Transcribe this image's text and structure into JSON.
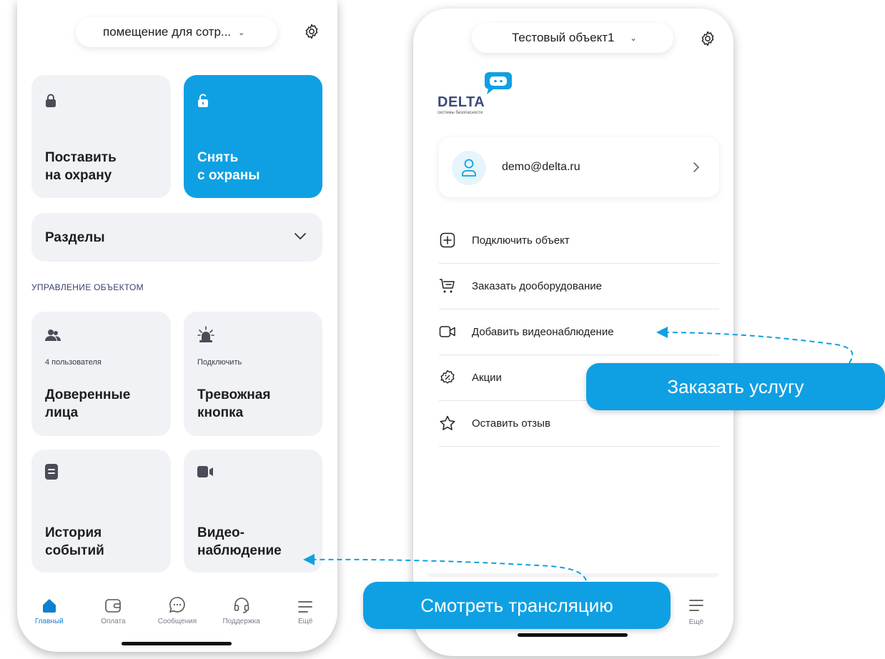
{
  "left_phone": {
    "object_selector": "помещение для сотр...",
    "arm_card": {
      "title_line1": "Поставить",
      "title_line2": "на охрану"
    },
    "disarm_card": {
      "title_line1": "Снять",
      "title_line2": "с охраны"
    },
    "sections": {
      "label": "Разделы"
    },
    "management_label": "УПРАВЛЕНИЕ ОБЪЕКТОМ",
    "trusted": {
      "sub": "4 пользователя",
      "title_line1": "Доверенные",
      "title_line2": "лица"
    },
    "panic": {
      "sub": "Подключить",
      "title_line1": "Тревожная",
      "title_line2": "кнопка"
    },
    "history": {
      "title_line1": "История",
      "title_line2": "событий"
    },
    "video": {
      "title_line1": "Видео-",
      "title_line2": "наблюдение"
    },
    "tabs": [
      {
        "label": "Главный",
        "icon": "home-icon",
        "active": true
      },
      {
        "label": "Оплата",
        "icon": "wallet-icon"
      },
      {
        "label": "Сообщения",
        "icon": "chat-icon"
      },
      {
        "label": "Поддержка",
        "icon": "headset-icon"
      },
      {
        "label": "Ещё",
        "icon": "menu-icon"
      }
    ]
  },
  "right_phone": {
    "object_selector": "Тестовый объект1",
    "logo": {
      "name": "DELTA",
      "tagline": "системы безопасности"
    },
    "account": {
      "email": "demo@delta.ru"
    },
    "menu": [
      {
        "label": "Подключить объект",
        "icon": "plus-square-icon"
      },
      {
        "label": "Заказать дооборудование",
        "icon": "cart-icon"
      },
      {
        "label": "Добавить видеонаблюдение",
        "icon": "camera-icon"
      },
      {
        "label": "Акции",
        "icon": "discount-icon"
      },
      {
        "label": "Оставить отзыв",
        "icon": "star-icon"
      }
    ],
    "tab_more": "Ещё"
  },
  "callouts": {
    "order_service": "Заказать услугу",
    "watch_stream": "Смотреть трансляцию"
  },
  "colors": {
    "accent": "#0fa0e3",
    "card": "#f1f2f5",
    "active_tab": "#0f7fd0"
  }
}
